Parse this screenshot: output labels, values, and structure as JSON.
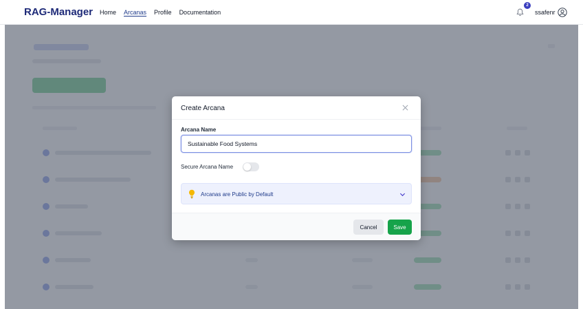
{
  "navbar": {
    "brand": "RAG-Manager",
    "links": [
      {
        "label": "Home",
        "active": false
      },
      {
        "label": "Arcanas",
        "active": true
      },
      {
        "label": "Profile",
        "active": false
      },
      {
        "label": "Documentation",
        "active": false
      }
    ],
    "notification_count": "2",
    "username": "ssafenr",
    "icons": {
      "notifications": "bell-icon",
      "account": "user-circle-icon"
    }
  },
  "modal": {
    "title": "Create Arcana",
    "close_icon": "close-icon",
    "name_label": "Arcana Name",
    "name_value": "Sustainable Food Systems",
    "secure_label": "Secure Arcana Name",
    "secure_enabled": false,
    "info_icon": "lightbulb-icon",
    "info_title": "Arcanas are Public by Default",
    "info_expanded": false,
    "cancel_label": "Cancel",
    "save_label": "Save"
  },
  "colors": {
    "brand": "#1e2a78",
    "primary": "#3b3fbf",
    "save": "#16a34a",
    "overlay": "#6b7280",
    "info_bg": "#eef1fd"
  }
}
